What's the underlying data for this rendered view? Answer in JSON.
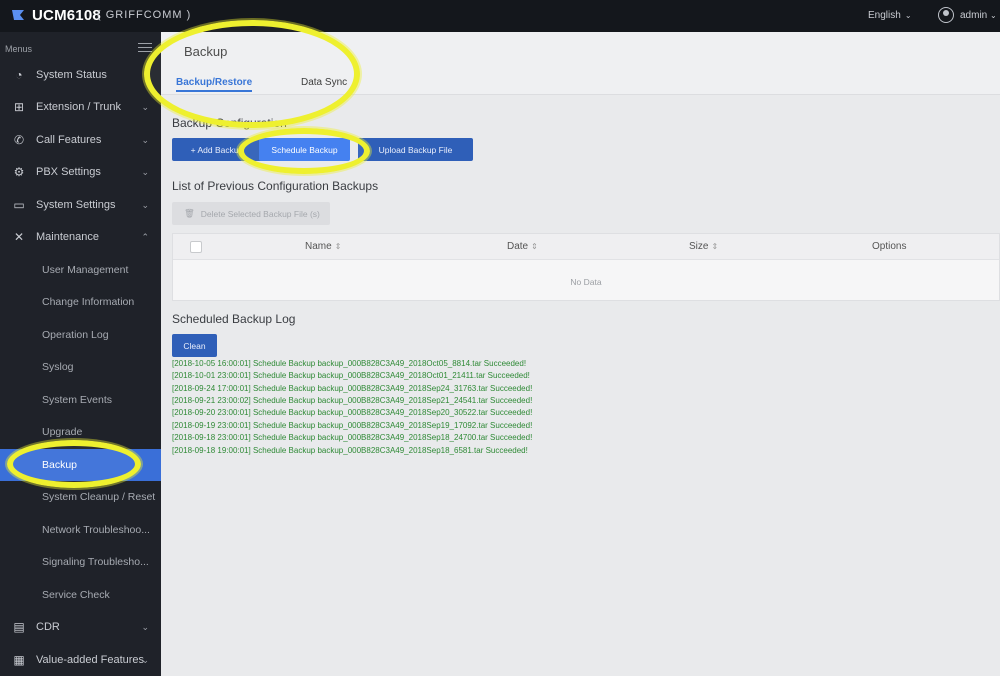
{
  "app": {
    "brand": "UCM6108",
    "brand_sub": "( GRIFFCOMM )",
    "language": "English",
    "user": "admin"
  },
  "sidebar": {
    "header": "Menus",
    "items": [
      {
        "label": "System Status",
        "icon": "gauge-icon"
      },
      {
        "label": "Extension / Trunk",
        "icon": "sitemap-icon"
      },
      {
        "label": "Call Features",
        "icon": "phone-icon"
      },
      {
        "label": "PBX Settings",
        "icon": "gear-icon"
      },
      {
        "label": "System Settings",
        "icon": "monitor-gear-icon"
      },
      {
        "label": "Maintenance",
        "icon": "wrench-icon"
      }
    ],
    "maintenance_sub": [
      "User Management",
      "Change Information",
      "Operation Log",
      "Syslog",
      "System Events",
      "Upgrade",
      "Backup",
      "System Cleanup / Reset",
      "Network Troubleshoo...",
      "Signaling Troublesho...",
      "Service Check"
    ],
    "bottom_items": [
      {
        "label": "CDR",
        "icon": "document-icon"
      },
      {
        "label": "Value-added Features",
        "icon": "grid-icon"
      }
    ]
  },
  "page": {
    "title": "Backup",
    "tabs": [
      "Backup/Restore",
      "Data Sync"
    ]
  },
  "backup_config": {
    "title": "Backup Configuration",
    "add_button": "+ Add Backup",
    "schedule_button": "Schedule Backup",
    "upload_button": "Upload Backup File"
  },
  "previous": {
    "title": "List of Previous Configuration Backups",
    "delete_button": "Delete Selected Backup File (s)",
    "columns": [
      "Name",
      "Date",
      "Size",
      "Options"
    ],
    "empty": "No Data"
  },
  "log": {
    "title": "Scheduled Backup Log",
    "clean_button": "Clean",
    "lines": [
      "[2018-10-05 16:00:01] Schedule Backup backup_000B828C3A49_2018Oct05_8814.tar Succeeded!",
      "[2018-10-01 23:00:01] Schedule Backup backup_000B828C3A49_2018Oct01_21411.tar Succeeded!",
      "[2018-09-24 17:00:01] Schedule Backup backup_000B828C3A49_2018Sep24_31763.tar Succeeded!",
      "[2018-09-21 23:00:02] Schedule Backup backup_000B828C3A49_2018Sep21_24541.tar Succeeded!",
      "[2018-09-20 23:00:01] Schedule Backup backup_000B828C3A49_2018Sep20_30522.tar Succeeded!",
      "[2018-09-19 23:00:01] Schedule Backup backup_000B828C3A49_2018Sep19_17092.tar Succeeded!",
      "[2018-09-18 23:00:01] Schedule Backup backup_000B828C3A49_2018Sep18_24700.tar Succeeded!",
      "[2018-09-18 19:00:01] Schedule Backup backup_000B828C3A49_2018Sep18_6581.tar Succeeded!"
    ]
  },
  "colors": {
    "accent": "#3b7bf0",
    "highlight": "#eef02f",
    "log_text": "#2f8a36"
  }
}
